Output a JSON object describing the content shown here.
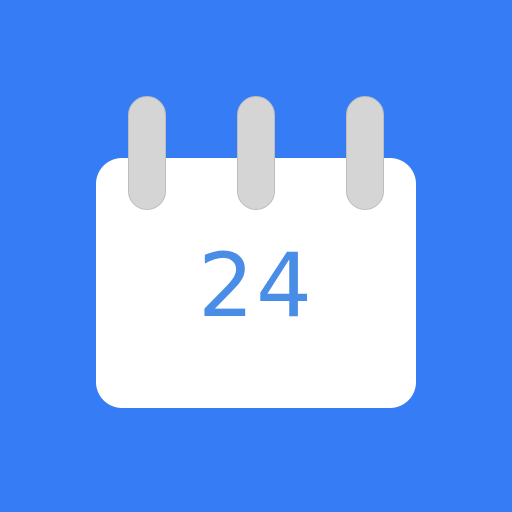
{
  "calendar_icon": {
    "day_number": "24",
    "background_color": "#357CF5",
    "page_color": "#FFFFFF",
    "ring_color": "#D5D5D5",
    "number_color": "#4A8DE6"
  }
}
